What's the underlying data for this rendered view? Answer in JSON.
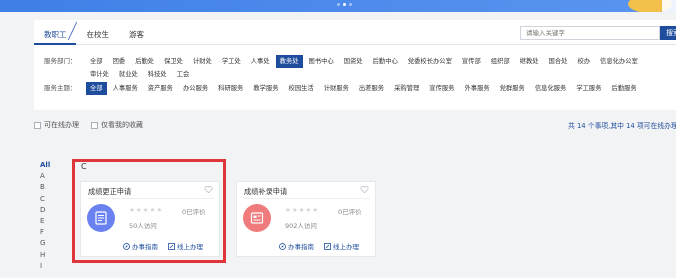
{
  "tabs": [
    {
      "label": "教职工",
      "active": true
    },
    {
      "label": "在校生",
      "active": false
    },
    {
      "label": "游客",
      "active": false
    }
  ],
  "search": {
    "placeholder": "请输入关键字",
    "button_label": "搜索"
  },
  "filters": {
    "department": {
      "label": "服务部门：",
      "items": [
        "全部",
        "团委",
        "后勤处",
        "保卫处",
        "计财处",
        "学工处",
        "人事处",
        "教务处",
        "图书中心",
        "国资处",
        "后勤中心",
        "党委校长办公室",
        "宣传部",
        "组织部",
        "继教处",
        "国合处",
        "校办",
        "信息化办公室",
        "审计处",
        "就业处",
        "科技处",
        "工会"
      ],
      "active": "教务处"
    },
    "topic": {
      "label": "服务主题：",
      "items": [
        "全部",
        "人事服务",
        "资产服务",
        "办公服务",
        "科研服务",
        "教学服务",
        "校园生活",
        "计财服务",
        "出差服务",
        "采购管理",
        "宣传服务",
        "外事服务",
        "党群服务",
        "信息化服务",
        "学工服务",
        "后勤服务"
      ],
      "active": "全部"
    }
  },
  "options": {
    "online_label": "可在线办理",
    "favorites_label": "仅看我的收藏"
  },
  "summary": "共 14 个事项,其中 14 项可在线办理",
  "alphabet": [
    "All",
    "A",
    "B",
    "C",
    "D",
    "E",
    "F",
    "G",
    "H",
    "I"
  ],
  "alphabet_active": "All",
  "group_letter": "C",
  "cards": [
    {
      "title": "成绩更正申请",
      "rating": "0已评价",
      "visits": "50人访问",
      "guide": "办事指南",
      "online": "线上办理",
      "color": "#6a82f0"
    },
    {
      "title": "成绩补录申请",
      "rating": "0已评价",
      "visits": "902人访问",
      "guide": "办事指南",
      "online": "线上办理",
      "color": "#f07b7d"
    }
  ],
  "colors": {
    "accent": "#1f4d9e",
    "highlight": "#e0353a"
  }
}
